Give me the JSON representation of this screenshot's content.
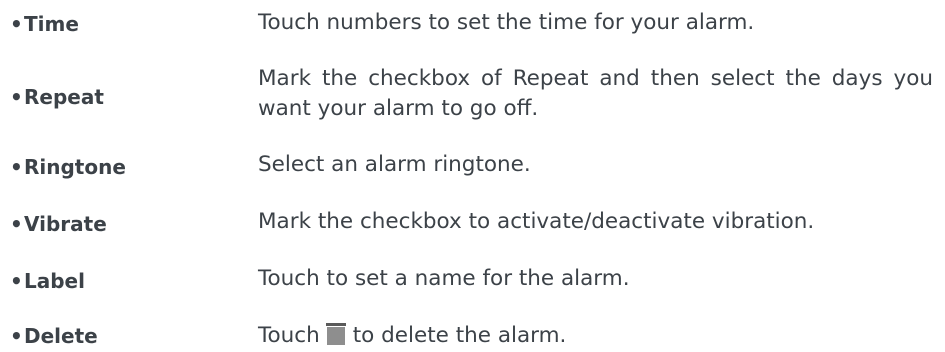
{
  "items": [
    {
      "term": "Time",
      "description": "Touch numbers to set the time for your alarm."
    },
    {
      "term": "Repeat",
      "description": "Mark the checkbox of Repeat and then select the days you want your alarm to go off."
    },
    {
      "term": "Ringtone",
      "description": "Select an alarm ringtone."
    },
    {
      "term": "Vibrate",
      "description": "Mark the checkbox to activate/deactivate vibration."
    },
    {
      "term": "Label",
      "description": "Touch to set a name for the alarm."
    },
    {
      "term": "Delete",
      "description_before": "Touch",
      "icon": "trash-icon",
      "description_after": "to delete the alarm."
    }
  ],
  "bullet": "•"
}
